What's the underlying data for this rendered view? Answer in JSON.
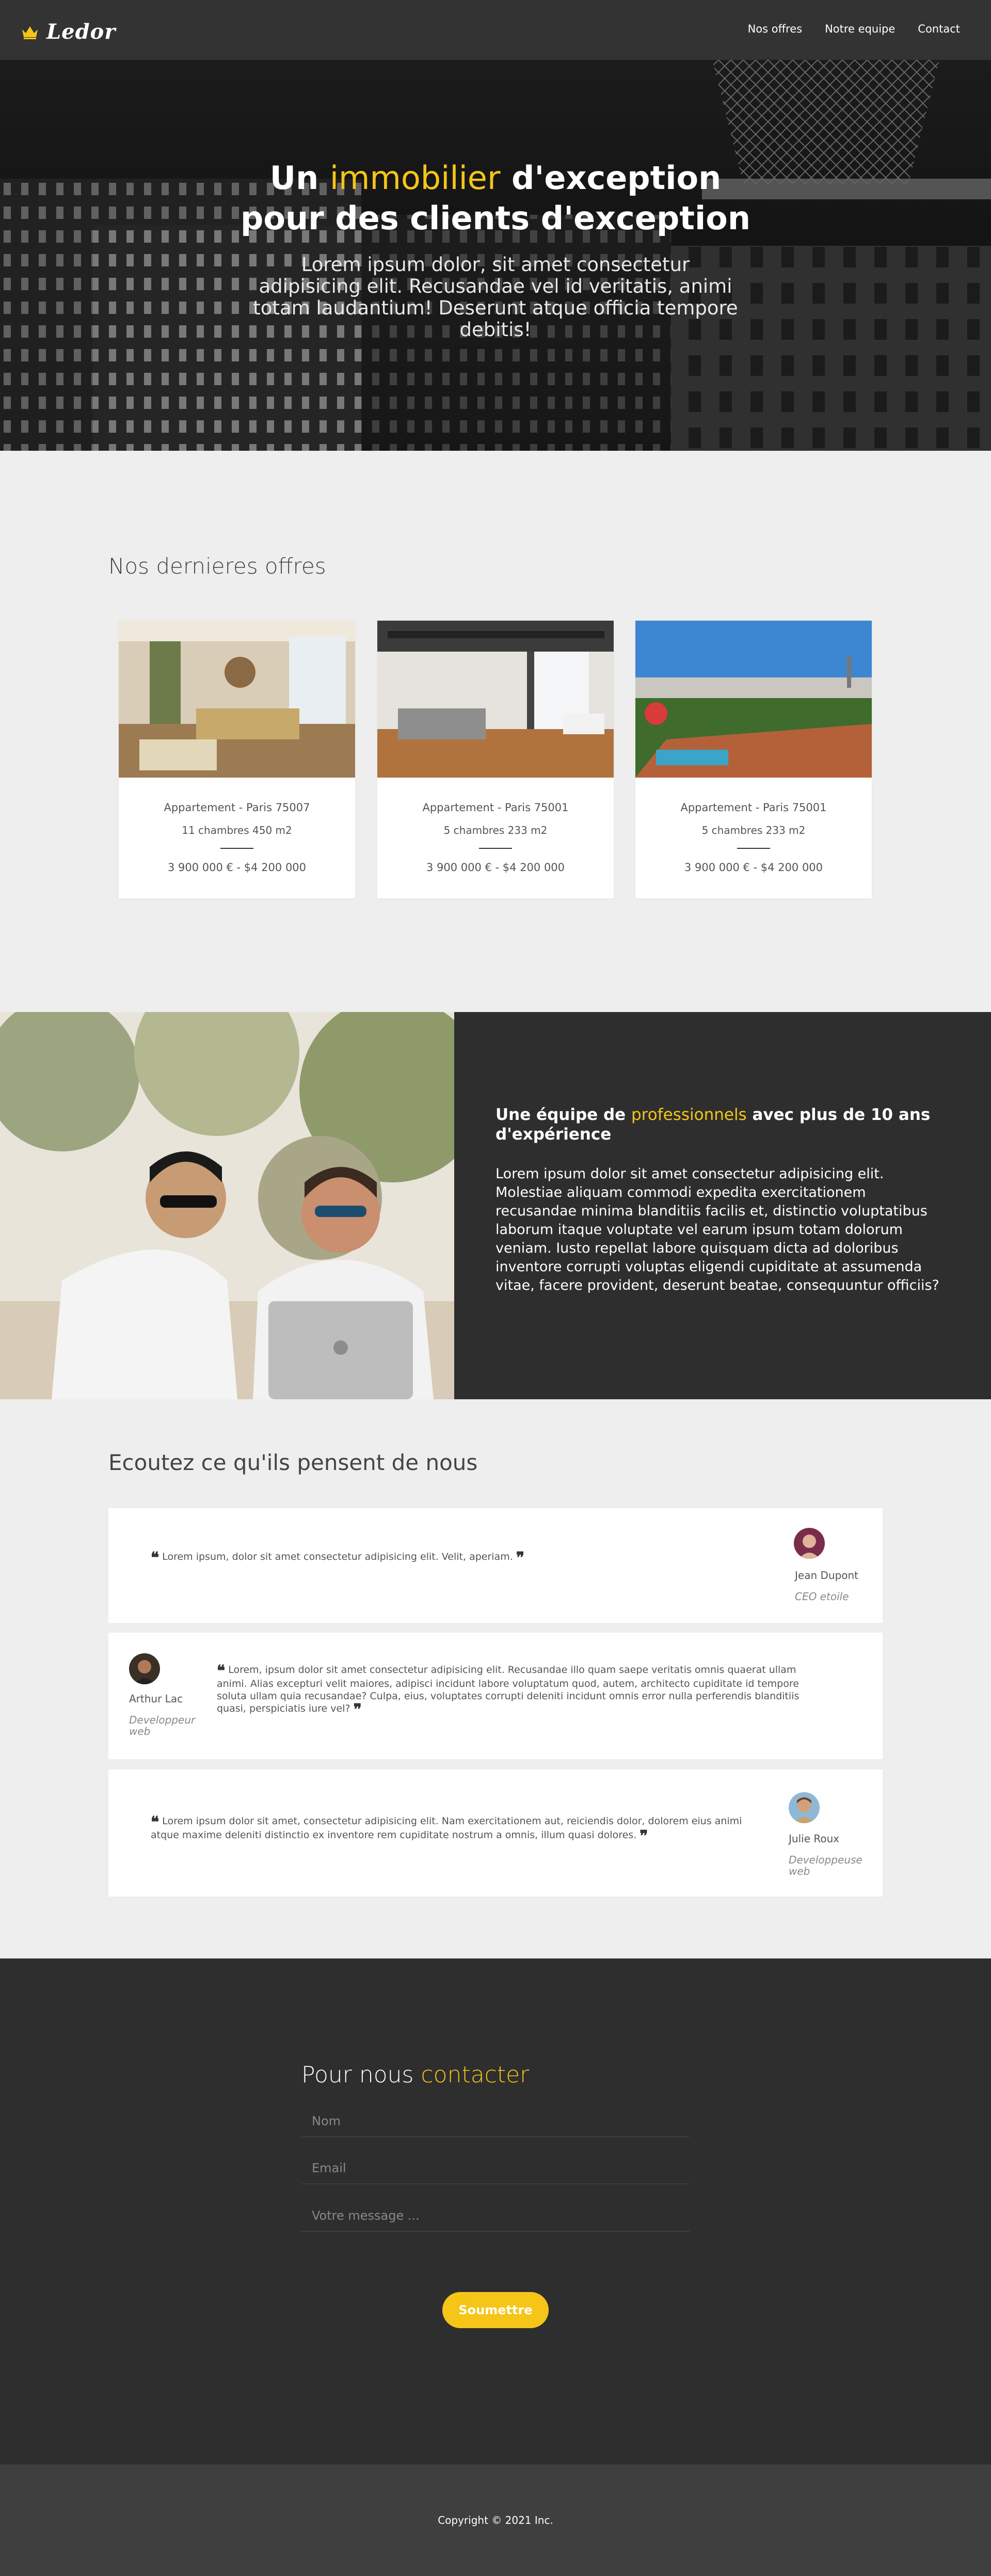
{
  "brand": {
    "name": "Ledor",
    "accent_color": "#f5c518",
    "icon": "crown-icon"
  },
  "nav": {
    "items": [
      "Nos offres",
      "Notre equipe",
      "Contact"
    ]
  },
  "hero": {
    "title_part1": "Un ",
    "title_accent": "immobilier",
    "title_part2": " d'exception",
    "title_line2": "pour des clients d'exception",
    "subtitle": "Lorem ipsum dolor, sit amet consectetur adipisicing elit. Recusandae vel id veritatis, animi totam laudantium! Deserunt atque officia tempore debitis!"
  },
  "offers": {
    "title": "Nos dernieres offres",
    "items": [
      {
        "location": "Appartement - Paris 75007",
        "rooms": "11 chambres 450 m2",
        "price": "3 900 000 € - $4 200 000"
      },
      {
        "location": "Appartement - Paris 75001",
        "rooms": "5 chambres 233 m2",
        "price": "3 900 000 € - $4 200 000"
      },
      {
        "location": "Appartement - Paris 75001",
        "rooms": "5 chambres 233 m2",
        "price": "3 900 000 € - $4 200 000"
      }
    ]
  },
  "team": {
    "heading_part1": "Une équipe de ",
    "heading_accent": "professionnels",
    "heading_part2": " avec plus de 10 ans d'expérience",
    "body": "Lorem ipsum dolor sit amet consectetur adipisicing elit. Molestiae aliquam commodi expedita exercitationem recusandae minima blanditiis facilis et, distinctio voluptatibus laborum itaque voluptate vel earum ipsum totam dolorum veniam. Iusto repellat labore quisquam dicta ad doloribus inventore corrupti voluptas eligendi cupiditate at assumenda vitae, facere provident, deserunt beatae, consequuntur officiis?"
  },
  "testimonials": {
    "title": "Ecoutez ce qu'ils pensent de nous",
    "items": [
      {
        "quote": "Lorem ipsum, dolor sit amet consectetur adipisicing elit. Velit, aperiam.",
        "name": "Jean Dupont",
        "role": "CEO etoile"
      },
      {
        "quote": "Lorem, ipsum dolor sit amet consectetur adipisicing elit. Recusandae illo quam saepe veritatis omnis quaerat ullam animi. Alias excepturi velit maiores, adipisci incidunt labore voluptatum quod, autem, architecto cupiditate id tempore soluta ullam quia recusandae? Culpa, eius, voluptates corrupti deleniti incidunt omnis error nulla perferendis blanditiis quasi, perspiciatis iure vel?",
        "name": "Arthur Lac",
        "role": "Developpeur web"
      },
      {
        "quote": "Lorem ipsum dolor sit amet, consectetur adipisicing elit. Nam exercitationem aut, reiciendis dolor, dolorem eius animi atque maxime deleniti distinctio ex inventore rem cupiditate nostrum a omnis, illum quasi dolores.",
        "name": "Julie Roux",
        "role": "Developpeuse web"
      }
    ]
  },
  "contact": {
    "title_part1": "Pour nous ",
    "title_accent": "contacter",
    "name_placeholder": "Nom",
    "email_placeholder": "Email",
    "message_placeholder": "Votre message ...",
    "submit_label": "Soumettre"
  },
  "footer": {
    "copyright": "Copyright © 2021 Inc."
  }
}
